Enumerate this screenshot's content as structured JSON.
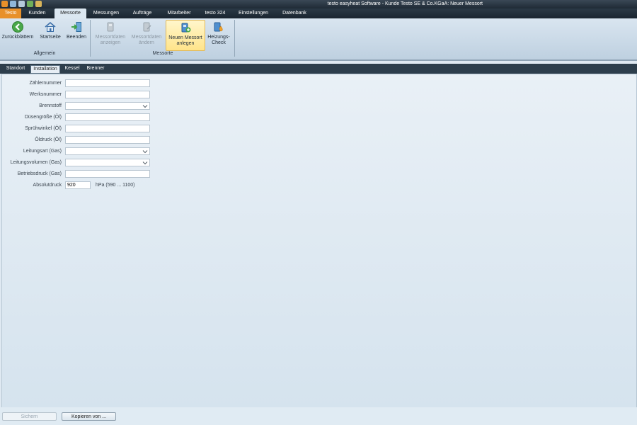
{
  "window": {
    "title": "testo easyheat Software - Kunde Testo SE & Co.KGaA: Neuer Messort"
  },
  "menu": {
    "items": [
      {
        "label": "Testo"
      },
      {
        "label": "Kunden"
      },
      {
        "label": "Messorte"
      },
      {
        "label": "Messungen"
      },
      {
        "label": "Aufträge"
      },
      {
        "label": "Mitarbeiter"
      },
      {
        "label": "testo 324"
      },
      {
        "label": "Einstellungen"
      },
      {
        "label": "Datenbank"
      }
    ],
    "active": "Messorte"
  },
  "ribbon": {
    "groups": [
      {
        "label": "Allgemein",
        "buttons": [
          {
            "label": "Zurückblättern",
            "icon": "back-arrow-icon"
          },
          {
            "label": "Startseite",
            "icon": "home-icon"
          },
          {
            "label": "Beenden",
            "icon": "exit-icon"
          }
        ]
      },
      {
        "label": "Messorte",
        "buttons": [
          {
            "line1": "Messortdaten",
            "line2": "anzeigen",
            "icon": "location-view-icon",
            "disabled": true
          },
          {
            "line1": "Messortdaten",
            "line2": "ändern",
            "icon": "location-edit-icon",
            "disabled": true
          },
          {
            "line1": "Neuen Messort",
            "line2": "anlegen",
            "icon": "location-new-icon",
            "highlight": true
          },
          {
            "line1": "Heizungs-",
            "line2": "Check",
            "icon": "heating-check-icon"
          }
        ]
      }
    ]
  },
  "tabs": [
    {
      "label": "Standort"
    },
    {
      "label": "Installation"
    },
    {
      "label": "Kessel"
    },
    {
      "label": "Brenner"
    }
  ],
  "active_tab": "Installation",
  "form": {
    "fields": [
      {
        "label": "Zählernummer",
        "type": "text",
        "value": ""
      },
      {
        "label": "Werksnummer",
        "type": "text",
        "value": ""
      },
      {
        "label": "Brennstoff",
        "type": "select",
        "value": ""
      },
      {
        "label": "Düsengröße (Öl)",
        "type": "text",
        "value": ""
      },
      {
        "label": "Sprühwinkel (Öl)",
        "type": "text",
        "value": ""
      },
      {
        "label": "Öldruck (Öl)",
        "type": "text",
        "value": ""
      },
      {
        "label": "Leitungsart (Gas)",
        "type": "select",
        "value": ""
      },
      {
        "label": "Leitungsvolumen (Gas)",
        "type": "select",
        "value": ""
      },
      {
        "label": "Betriebsdruck (Gas)",
        "type": "text",
        "value": ""
      },
      {
        "label": "Absolutdruck",
        "type": "text",
        "value": "920",
        "unit": "hPa (590 ... 1100)"
      }
    ]
  },
  "footer": {
    "save_label": "Sichern",
    "copy_label": "Kopieren von ..."
  },
  "colors": {
    "accent": "#e8902a",
    "menubar": "#1f2a35",
    "ribbon": "#cddbe8"
  }
}
